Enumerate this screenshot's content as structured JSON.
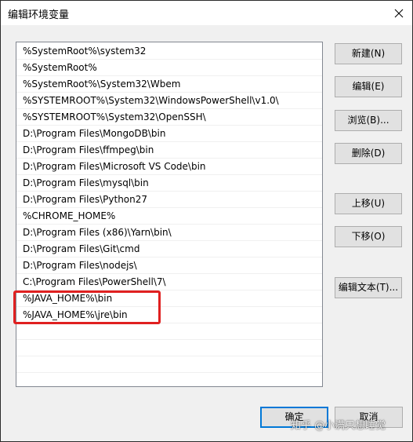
{
  "window": {
    "title": "编辑环境变量"
  },
  "path_list": {
    "items": [
      "%SystemRoot%\\system32",
      "%SystemRoot%",
      "%SystemRoot%\\System32\\Wbem",
      "%SYSTEMROOT%\\System32\\WindowsPowerShell\\v1.0\\",
      "%SYSTEMROOT%\\System32\\OpenSSH\\",
      "D:\\Program Files\\MongoDB\\bin",
      "D:\\Program Files\\ffmpeg\\bin",
      "D:\\Program Files\\Microsoft VS Code\\bin",
      "D:\\Program Files\\mysql\\bin",
      "D:\\Program Files\\Python27",
      "%CHROME_HOME%",
      "D:\\Program Files (x86)\\Yarn\\bin\\",
      "D:\\Program Files\\Git\\cmd",
      "D:\\Program Files\\nodejs\\",
      "C:\\Program Files\\PowerShell\\7\\",
      "%JAVA_HOME%\\bin",
      "%JAVA_HOME%\\jre\\bin"
    ],
    "highlight_color": "#e02020"
  },
  "buttons": {
    "new": "新建(N)",
    "edit": "编辑(E)",
    "browse": "浏览(B)...",
    "delete": "删除(D)",
    "move_up": "上移(U)",
    "move_down": "下移(O)",
    "edit_text": "编辑文本(T)...",
    "ok": "确定",
    "cancel": "取消"
  },
  "watermark": "知乎 @小满只想睡觉",
  "icons": {
    "close": "close-icon"
  }
}
